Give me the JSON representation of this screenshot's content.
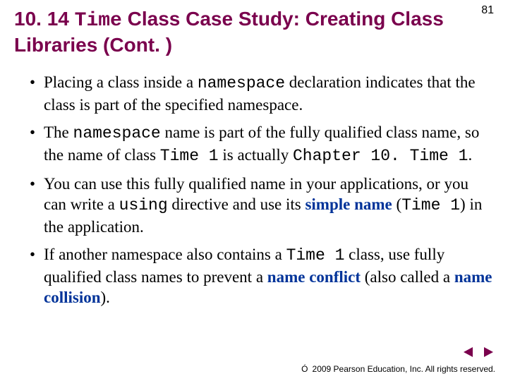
{
  "page_number": "81",
  "title": {
    "section_num": "10. 14",
    "code_word": "Time",
    "rest": " Class Case Study: Creating Class Libraries (Cont. )"
  },
  "bullets": [
    {
      "parts": [
        {
          "t": "Placing a class inside a "
        },
        {
          "t": "namespace",
          "code": true
        },
        {
          "t": " declaration indicates that the class is part of the specified namespace."
        }
      ]
    },
    {
      "parts": [
        {
          "t": "The "
        },
        {
          "t": "namespace",
          "code": true
        },
        {
          "t": " name is part of the fully qualified class name, so the name of class "
        },
        {
          "t": "Time 1",
          "code": true
        },
        {
          "t": " is actually­ "
        },
        {
          "t": "Chapter 10. Time 1",
          "code": true
        },
        {
          "t": "."
        }
      ]
    },
    {
      "parts": [
        {
          "t": "You can use this fully qualified name in your applications, or you can write a "
        },
        {
          "t": "using",
          "code": true
        },
        {
          "t": " directive and use its "
        },
        {
          "t": "simple name",
          "term": true
        },
        {
          "t": " ("
        },
        {
          "t": "Time 1",
          "code": true
        },
        {
          "t": ") in the application."
        }
      ]
    },
    {
      "parts": [
        {
          "t": "If another namespace also contains a "
        },
        {
          "t": "Time 1",
          "code": true
        },
        {
          "t": " class, use fully qualified class names to prevent a "
        },
        {
          "t": "name conflict",
          "term": true
        },
        {
          "t": " (also called a "
        },
        {
          "t": "name collision",
          "term": true
        },
        {
          "t": ")."
        }
      ]
    }
  ],
  "footer": {
    "copyright_symbol": "Ó",
    "text": "2009 Pearson Education, Inc.  All rights reserved."
  },
  "nav": {
    "prev_icon": "prev",
    "next_icon": "next",
    "color": "#7a004d"
  }
}
